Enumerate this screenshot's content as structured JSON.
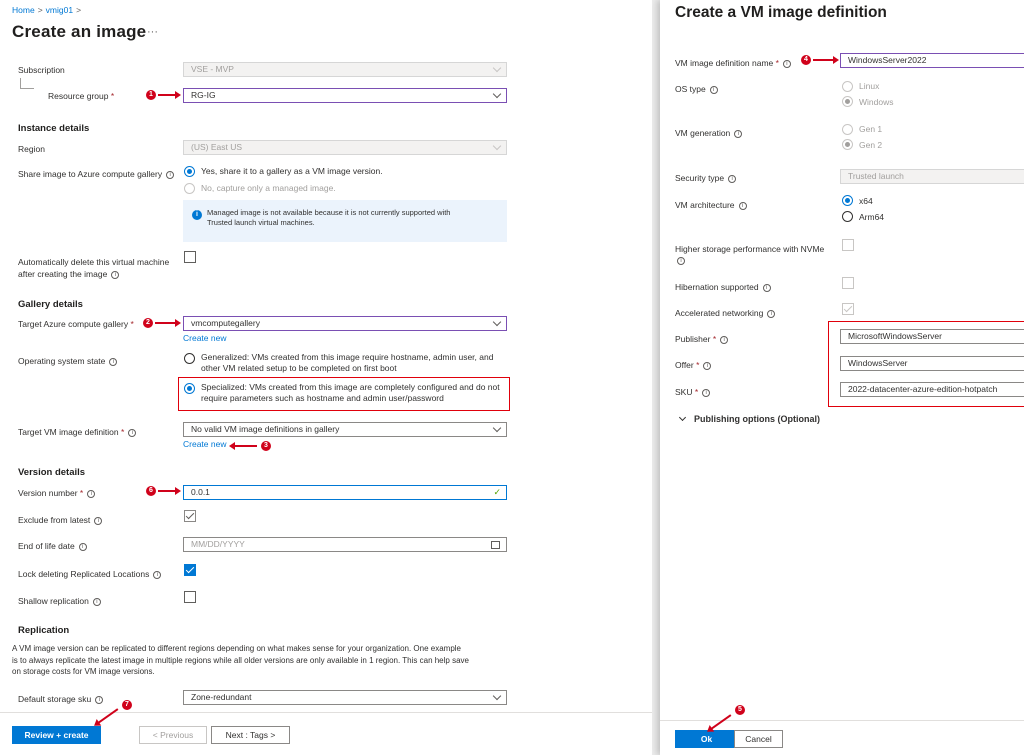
{
  "left": {
    "breadcrumb": [
      "Home",
      "vmig01"
    ],
    "title": "Create an image",
    "more": "···",
    "subscription": {
      "label": "Subscription",
      "value": "VSE - MVP"
    },
    "resource_group": {
      "label": "Resource group",
      "value": "RG-IG"
    },
    "instance_details": {
      "heading": "Instance details",
      "region_label": "Region",
      "region_value": "(US) East US"
    },
    "share": {
      "label": "Share image to Azure compute gallery",
      "opt_yes": "Yes, share it to a gallery as a VM image version.",
      "opt_no": "No, capture only a managed image.",
      "info_line1": "Managed image is not available because it is not currently supported with",
      "info_line2": "Trusted launch virtual machines."
    },
    "auto_delete": {
      "line1": "Automatically delete this virtual machine",
      "line2": "after creating the image"
    },
    "gallery_details": {
      "heading": "Gallery details",
      "target_gallery_label": "Target Azure compute gallery",
      "target_gallery_value": "vmcomputegallery",
      "create_new": "Create new",
      "os_state_label": "Operating system state",
      "generalized_1": "Generalized: VMs created from this image require hostname, admin user, and",
      "generalized_2": "other VM related setup to be completed on first boot",
      "specialized_1": "Specialized: VMs created from this image are completely configured and do not",
      "specialized_2": "require parameters such as hostname and admin user/password",
      "target_def_label": "Target VM image definition",
      "target_def_value": "No valid VM image definitions in gallery",
      "create_new_2": "Create new"
    },
    "version_details": {
      "heading": "Version details",
      "version_label": "Version number",
      "version_value": "0.0.1",
      "exclude_label": "Exclude from latest",
      "eol_label": "End of life date",
      "eol_placeholder": "MM/DD/YYYY",
      "lock_label": "Lock deleting Replicated Locations",
      "shallow_label": "Shallow replication"
    },
    "replication": {
      "heading": "Replication",
      "text_1": "A VM image version can be replicated to different regions depending on what makes sense for your organization. One example",
      "text_2": "is to always replicate the latest image in multiple regions while all older versions are only available in 1 region. This can help save",
      "text_3": "on storage costs for VM image versions.",
      "storage_label": "Default storage sku",
      "storage_value": "Zone-redundant"
    },
    "footer": {
      "review": "Review + create",
      "previous": "< Previous",
      "next": "Next : Tags >"
    }
  },
  "right": {
    "title": "Create a VM image definition",
    "def_name_label": "VM image definition name",
    "def_name_value": "WindowsServer2022",
    "os_type_label": "OS type",
    "os_linux": "Linux",
    "os_windows": "Windows",
    "vm_gen_label": "VM generation",
    "gen1": "Gen 1",
    "gen2": "Gen 2",
    "security_label": "Security type",
    "security_value": "Trusted launch",
    "arch_label": "VM architecture",
    "arch_x64": "x64",
    "arch_arm": "Arm64",
    "nvme_label": "Higher storage performance with NVMe",
    "hibernation_label": "Hibernation supported",
    "accel_label": "Accelerated networking",
    "publisher_label": "Publisher",
    "publisher_value": "MicrosoftWindowsServer",
    "offer_label": "Offer",
    "offer_value": "WindowsServer",
    "sku_label": "SKU",
    "sku_value": "2022-datacenter-azure-edition-hotpatch",
    "publishing": "Publishing options (Optional)",
    "ok": "Ok",
    "cancel": "Cancel"
  },
  "annotations": [
    "1",
    "2",
    "3",
    "4",
    "5",
    "6",
    "7"
  ],
  "colors": {
    "accent": "#0078d4",
    "callout": "#d0021b",
    "required": "#a4262c",
    "focus_border": "#7a4fb3"
  }
}
